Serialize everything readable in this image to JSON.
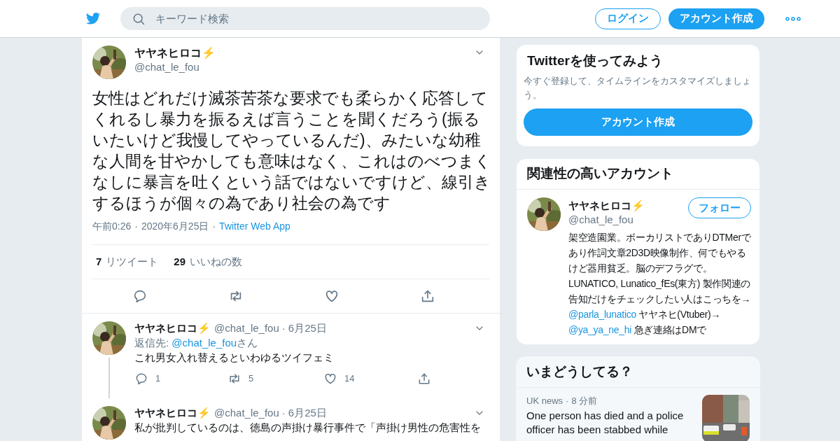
{
  "header": {
    "search": {
      "placeholder": "キーワード検索"
    },
    "buttons": [
      {
        "label": "ログイン",
        "kind": "outline"
      },
      {
        "label": "アカウント作成",
        "kind": "filled"
      }
    ]
  },
  "tweet": {
    "name": "ヤヤネヒロコ⚡",
    "handle": "@chat_le_fou",
    "text": "女性はどれだけ滅茶苦茶な要求でも柔らかく応答してくれるし暴力を振るえば言うことを聞くだろう(振るいたいけど我慢してやっているんだ)、みたいな幼稚な人間を甘やかしても意味はなく、これはのべつまくなしに暴言を吐くという話ではないですけど、線引きするほうが個々の為であり社会の為です",
    "separator": "·",
    "time": "午前0:26",
    "date": "2020年6月25日",
    "source": "Twitter Web App",
    "stats": [
      {
        "count": "7",
        "label": "リツイート"
      },
      {
        "count": "29",
        "label": "いいねの数"
      }
    ]
  },
  "replies": [
    {
      "name": "ヤヤネヒロコ⚡",
      "handle": "@chat_le_fou",
      "separator": "·",
      "date": "6月25日",
      "reply_to": {
        "prefix": "返信先:",
        "handle": "@chat_le_fou",
        "suffix": "さん"
      },
      "text": "これ男女入れ替えるといわゆるツイフェミ",
      "counts": {
        "reply": "1",
        "retweet": "5",
        "like": "14"
      },
      "thread": true
    },
    {
      "name": "ヤヤネヒロコ⚡",
      "handle": "@chat_le_fou",
      "separator": "·",
      "date": "6月25日",
      "text": "私が批判しているのは、徳島の声掛け暴行事件で「声掛け男性の危害性を",
      "thread": false
    }
  ],
  "sidebar": {
    "signup": {
      "title": "Twitterを使ってみよう",
      "text": "今すぐ登録して、タイムラインをカスタマイズしましょう。",
      "button": "アカウント作成"
    },
    "related": {
      "title": "関連性の高いアカウント",
      "account": {
        "name": "ヤヤネヒロコ⚡",
        "handle": "@chat_le_fou",
        "follow": "フォロー",
        "bio": [
          {
            "kind": "text",
            "text": "架空造園業。ボーカリストでありDTMerであり作詞文章2D3D映像制作、何でもやるけど器用貧乏。脳のデフラグで。LUNATICO, Lunatico_fEs(東方) 製作関連の告知だけをチェックしたい人はこっちを→ "
          },
          {
            "kind": "link",
            "text": "@parla_lunatico"
          },
          {
            "kind": "text",
            "text": " ヤヤネヒ(Vtuber)→ "
          },
          {
            "kind": "link",
            "text": "@ya_ya_ne_hi"
          },
          {
            "kind": "text",
            "text": " 急ぎ連絡はDMで"
          }
        ]
      }
    },
    "trends": {
      "title": "いまどうしてる？",
      "items": [
        {
          "category": "UK news",
          "separator": "·",
          "age": "8 分前",
          "headline": "One person has died and a police officer has been stabbed while",
          "kind": "picture"
        }
      ]
    }
  }
}
